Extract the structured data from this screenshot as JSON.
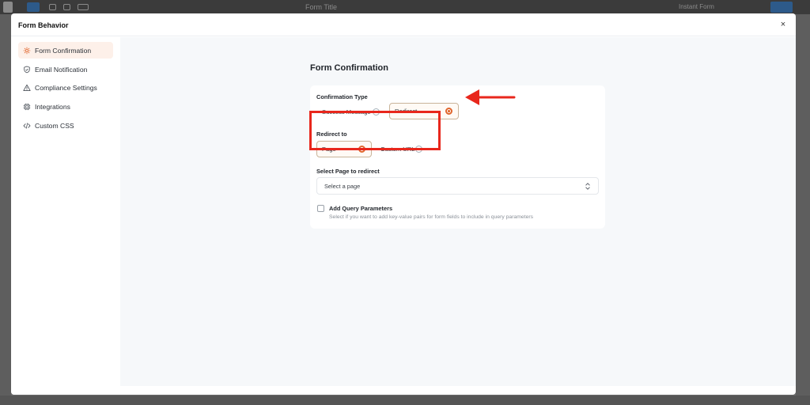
{
  "background": {
    "doc_title": "Form Title",
    "right_label": "Instant Form"
  },
  "modal": {
    "title": "Form Behavior",
    "close_label": "×"
  },
  "sidebar": {
    "items": [
      {
        "label": "Form Confirmation",
        "icon": "gear-icon",
        "active": true
      },
      {
        "label": "Email Notification",
        "icon": "shield-check-icon",
        "active": false
      },
      {
        "label": "Compliance Settings",
        "icon": "warning-icon",
        "active": false
      },
      {
        "label": "Integrations",
        "icon": "chip-icon",
        "active": false
      },
      {
        "label": "Custom CSS",
        "icon": "code-icon",
        "active": false
      }
    ]
  },
  "content": {
    "section_title": "Form Confirmation",
    "confirmation_type": {
      "label": "Confirmation Type",
      "options": [
        {
          "label": "Success Message",
          "selected": false
        },
        {
          "label": "Redirect",
          "selected": true
        }
      ]
    },
    "redirect_to": {
      "label": "Redirect to",
      "options": [
        {
          "label": "Page",
          "selected": true
        },
        {
          "label": "Custom URL",
          "selected": false
        }
      ]
    },
    "select_page": {
      "label": "Select Page to redirect",
      "placeholder": "Select a page"
    },
    "query_params": {
      "label": "Add Query Parameters",
      "help": "Select if you want to add key-value pairs for form fields to include in query parameters",
      "checked": false
    }
  },
  "colors": {
    "accent": "#e0662d",
    "annotation": "#e8271c",
    "active_nav_bg": "#fdf0e9"
  }
}
